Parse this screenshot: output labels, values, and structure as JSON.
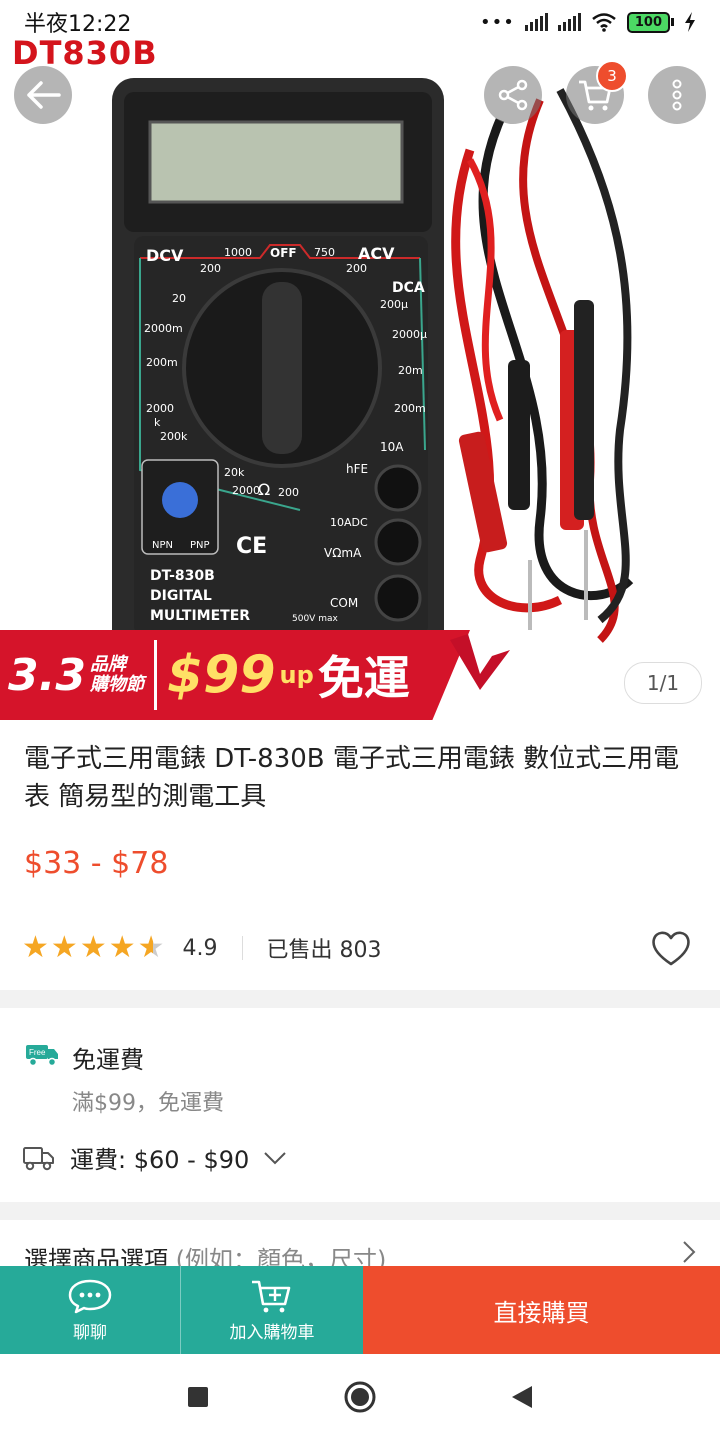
{
  "status_bar": {
    "time": "半夜12:22",
    "battery": "100"
  },
  "hero": {
    "brand_tag": "DT830B",
    "cart_count": "3",
    "page_indicator": "1/1",
    "promo_banner": {
      "event": "3.3",
      "event_sub_1": "品牌",
      "event_sub_2": "購物節",
      "price": "$99",
      "up": "up",
      "free": "免運"
    },
    "meter": {
      "model": "DT-830B",
      "line1": "DIGITAL",
      "line2": "MULTIMETER",
      "dcv": "DCV",
      "acv": "ACV",
      "dca": "DCA",
      "off": "OFF",
      "hfe": "hFE",
      "a10": "10A",
      "ohm": "Ω",
      "npn": "NPN",
      "pnp": "PNP",
      "com": "COM",
      "vma": "VΩmA",
      "adc": "10ADC",
      "max": "500V max",
      "ce": "CE",
      "r1000": "1000",
      "r200a": "200",
      "r750": "750",
      "r200b": "200",
      "r20": "20",
      "r2000m": "2000m",
      "r200m": "200m",
      "r2000k": "2000",
      "rk": "k",
      "r200k": "200k",
      "r20k": "20k",
      "r2000": "2000",
      "r200c": "200",
      "r200u": "200μ",
      "r2000u": "2000μ",
      "r20m": "20m",
      "r200m2": "200m",
      "r10a": "10A"
    }
  },
  "product": {
    "title": "電子式三用電錶 DT-830B 電子式三用電錶 數位式三用電表 簡易型的測電工具",
    "price_range": "$33 - $78",
    "rating": "4.9",
    "sold": "已售出 803",
    "rating_stars": 4.5
  },
  "shipping": {
    "free_badge": "Free",
    "free_title": "免運費",
    "free_condition": "滿$99，免運費",
    "fee": "運費: $60 - $90"
  },
  "options": {
    "label": "選擇商品選項",
    "hint": "(例如：顏色，尺寸)"
  },
  "action_bar": {
    "chat": "聊聊",
    "add_to_cart": "加入購物車",
    "buy_now": "直接購買"
  },
  "colors": {
    "primary": "#ee4d2d",
    "teal": "#26aa99",
    "star": "#f5a623"
  }
}
